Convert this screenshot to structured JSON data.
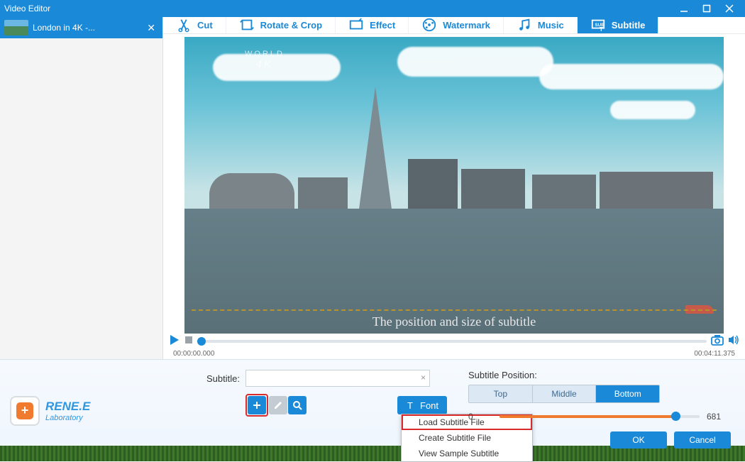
{
  "window": {
    "title": "Video Editor"
  },
  "file_tab": {
    "name": "London in 4K -..."
  },
  "toolbar": {
    "cut": "Cut",
    "rotate": "Rotate & Crop",
    "effect": "Effect",
    "watermark": "Watermark",
    "music": "Music",
    "subtitle": "Subtitle",
    "active": "subtitle"
  },
  "preview": {
    "watermark_line1": "WORLD",
    "watermark_line2": "4K",
    "subtitle_text": "The position and size of subtitle"
  },
  "playback": {
    "time_start": "00:00:00.000",
    "time_end": "00:04:11.375"
  },
  "logo": {
    "name": "RENE.E",
    "sub": "Laboratory"
  },
  "subtitle_panel": {
    "label": "Subtitle:",
    "input_value": "",
    "font_btn": "Font",
    "menu": {
      "load": "Load Subtitle File",
      "create": "Create Subtitle File",
      "view": "View Sample Subtitle"
    }
  },
  "position_panel": {
    "label": "Subtitle Position:",
    "top": "Top",
    "middle": "Middle",
    "bottom": "Bottom",
    "active": "bottom",
    "slider_min": "0",
    "slider_value": "681"
  },
  "actions": {
    "ok": "OK",
    "cancel": "Cancel"
  }
}
